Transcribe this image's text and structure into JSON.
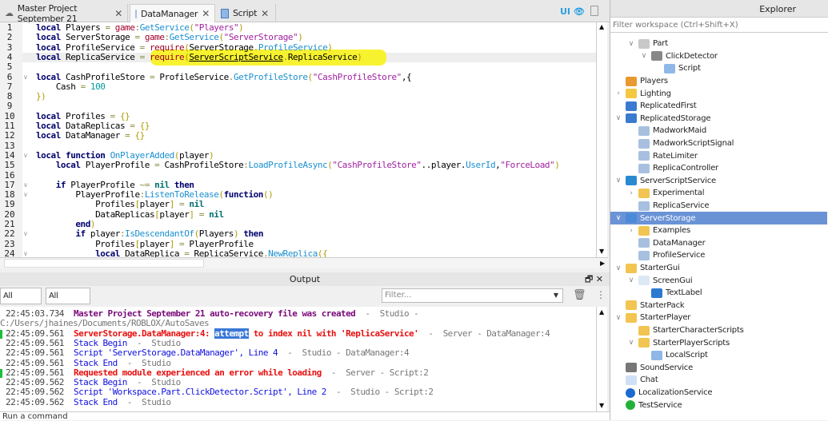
{
  "tabs": [
    {
      "label": "Master Project September 21",
      "icon": "cloud-icon",
      "active": false
    },
    {
      "label": "DataManager",
      "icon": "module-script-icon",
      "active": true
    },
    {
      "label": "Script",
      "icon": "script-icon",
      "active": false
    }
  ],
  "toolbar": {
    "ui_toggle": "UI"
  },
  "editor": {
    "current_line": 4,
    "highlight_color": "#f7f21a",
    "lines": [
      {
        "n": "1",
        "fold": false,
        "t": [
          [
            "kw",
            "local"
          ],
          [
            "id",
            " Players "
          ],
          [
            "op",
            "="
          ],
          [
            "req",
            " game"
          ],
          [
            "op",
            ":"
          ],
          [
            "fn",
            "GetService"
          ],
          [
            "br",
            "("
          ],
          [
            "str",
            "\"Players\""
          ],
          [
            "br",
            ")"
          ]
        ]
      },
      {
        "n": "2",
        "fold": false,
        "t": [
          [
            "kw",
            "local"
          ],
          [
            "id",
            " ServerStorage "
          ],
          [
            "op",
            "="
          ],
          [
            "req",
            " game"
          ],
          [
            "op",
            ":"
          ],
          [
            "fn",
            "GetService"
          ],
          [
            "br",
            "("
          ],
          [
            "str",
            "\"ServerStorage\""
          ],
          [
            "br",
            ")"
          ]
        ]
      },
      {
        "n": "3",
        "fold": false,
        "t": [
          [
            "kw",
            "local"
          ],
          [
            "id",
            " ProfileService "
          ],
          [
            "op",
            "="
          ],
          [
            "req",
            " require"
          ],
          [
            "br",
            "("
          ],
          [
            "id",
            "ServerStorage"
          ],
          [
            "op",
            "."
          ],
          [
            "fn",
            "ProfileService"
          ],
          [
            "br",
            ")"
          ]
        ]
      },
      {
        "n": "4",
        "fold": false,
        "t": [
          [
            "kw",
            "local"
          ],
          [
            "id",
            " ReplicaService "
          ],
          [
            "op",
            "= "
          ],
          [
            "req",
            "require"
          ],
          [
            "br",
            "("
          ],
          [
            "und",
            "ServerScriptService"
          ],
          [
            "op",
            "."
          ],
          [
            "id",
            "ReplicaService"
          ],
          [
            "br",
            ")"
          ]
        ]
      },
      {
        "n": "5",
        "fold": false,
        "t": []
      },
      {
        "n": "6",
        "fold": true,
        "t": [
          [
            "kw",
            "local"
          ],
          [
            "id",
            " CashProfileStore "
          ],
          [
            "op",
            "="
          ],
          [
            "id",
            " ProfileService"
          ],
          [
            "op",
            "."
          ],
          [
            "fn",
            "GetProfileStore"
          ],
          [
            "br",
            "("
          ],
          [
            "str",
            "\"CashProfileStore\""
          ],
          [
            "id",
            ",{"
          ]
        ]
      },
      {
        "n": "7",
        "fold": false,
        "t": [
          [
            "id",
            "    Cash "
          ],
          [
            "op",
            "="
          ],
          [
            "num",
            " 100"
          ]
        ]
      },
      {
        "n": "8",
        "fold": false,
        "t": [
          [
            "br",
            "})"
          ]
        ]
      },
      {
        "n": "9",
        "fold": false,
        "t": []
      },
      {
        "n": "10",
        "fold": false,
        "t": [
          [
            "kw",
            "local"
          ],
          [
            "id",
            " Profiles "
          ],
          [
            "op",
            "="
          ],
          [
            "br",
            " {}"
          ]
        ]
      },
      {
        "n": "11",
        "fold": false,
        "t": [
          [
            "kw",
            "local"
          ],
          [
            "id",
            " DataReplicas "
          ],
          [
            "op",
            "="
          ],
          [
            "br",
            " {}"
          ]
        ]
      },
      {
        "n": "12",
        "fold": false,
        "t": [
          [
            "kw",
            "local"
          ],
          [
            "id",
            " DataManager "
          ],
          [
            "op",
            "="
          ],
          [
            "br",
            " {}"
          ]
        ]
      },
      {
        "n": "13",
        "fold": false,
        "t": []
      },
      {
        "n": "14",
        "fold": true,
        "t": [
          [
            "kw",
            "local function"
          ],
          [
            "fn",
            " OnPlayerAdded"
          ],
          [
            "br",
            "("
          ],
          [
            "id",
            "player"
          ],
          [
            "br",
            ")"
          ]
        ]
      },
      {
        "n": "15",
        "fold": false,
        "t": [
          [
            "kw",
            "    local"
          ],
          [
            "id",
            " PlayerProfile "
          ],
          [
            "op",
            "="
          ],
          [
            "id",
            " CashProfileStore"
          ],
          [
            "op",
            ":"
          ],
          [
            "fn",
            "LoadProfileAsync"
          ],
          [
            "br",
            "("
          ],
          [
            "str",
            "\"CashProfileStore\""
          ],
          [
            "id",
            "..player."
          ],
          [
            "fn",
            "UserId"
          ],
          [
            "id",
            ","
          ],
          [
            "str",
            "\"ForceLoad\""
          ],
          [
            "br",
            ")"
          ]
        ]
      },
      {
        "n": "16",
        "fold": false,
        "t": []
      },
      {
        "n": "17",
        "fold": true,
        "t": [
          [
            "kw",
            "    if"
          ],
          [
            "id",
            " PlayerProfile "
          ],
          [
            "op",
            "~="
          ],
          [
            "nil",
            " nil"
          ],
          [
            "kw",
            " then"
          ]
        ]
      },
      {
        "n": "18",
        "fold": true,
        "t": [
          [
            "id",
            "        PlayerProfile"
          ],
          [
            "op",
            ":"
          ],
          [
            "fn",
            "ListenToRelease"
          ],
          [
            "br",
            "("
          ],
          [
            "kw",
            "function"
          ],
          [
            "br",
            "()"
          ]
        ]
      },
      {
        "n": "19",
        "fold": false,
        "t": [
          [
            "id",
            "            Profiles"
          ],
          [
            "br",
            "["
          ],
          [
            "id",
            "player"
          ],
          [
            "br",
            "]"
          ],
          [
            "op",
            " ="
          ],
          [
            "nil",
            " nil"
          ]
        ]
      },
      {
        "n": "20",
        "fold": false,
        "t": [
          [
            "id",
            "            DataReplicas"
          ],
          [
            "br",
            "["
          ],
          [
            "id",
            "player"
          ],
          [
            "br",
            "]"
          ],
          [
            "op",
            " ="
          ],
          [
            "nil",
            " nil"
          ]
        ]
      },
      {
        "n": "21",
        "fold": false,
        "t": [
          [
            "kw",
            "        end"
          ],
          [
            "br",
            ")"
          ]
        ]
      },
      {
        "n": "22",
        "fold": true,
        "t": [
          [
            "kw",
            "        if"
          ],
          [
            "id",
            " player"
          ],
          [
            "op",
            ":"
          ],
          [
            "fn",
            "IsDescendantOf"
          ],
          [
            "br",
            "("
          ],
          [
            "id",
            "Players"
          ],
          [
            "br",
            ")"
          ],
          [
            "kw",
            " then"
          ]
        ]
      },
      {
        "n": "23",
        "fold": false,
        "t": [
          [
            "id",
            "            Profiles"
          ],
          [
            "br",
            "["
          ],
          [
            "id",
            "player"
          ],
          [
            "br",
            "]"
          ],
          [
            "op",
            " ="
          ],
          [
            "id",
            " PlayerProfile"
          ]
        ]
      },
      {
        "n": "24",
        "fold": true,
        "t": [
          [
            "kw",
            "            local"
          ],
          [
            "id",
            " DataReplica "
          ],
          [
            "op",
            "="
          ],
          [
            "id",
            " ReplicaService"
          ],
          [
            "op",
            "."
          ],
          [
            "fn",
            "NewReplica"
          ],
          [
            "br",
            "({"
          ]
        ]
      }
    ]
  },
  "output": {
    "title": "Output",
    "messages_filter": "All Messages",
    "contexts_filter": "All Contexts",
    "filter_placeholder": "Filter...",
    "command_placeholder": "Run a command",
    "entries": [
      {
        "time": "22:45:03.734",
        "msg": "Master Project September 21 auto-recovery file was created",
        "style": "purple",
        "src": "Studio - C:/Users/jhaines/Documents/ROBLOX/AutoSaves",
        "mark": false
      },
      {
        "time": "22:45:09.561",
        "msg_pre": "ServerStorage.DataManager:4: ",
        "msg_sel": "attempt",
        "msg": " to index nil with 'ReplicaService'",
        "style": "red",
        "src": "Server - DataManager:4",
        "mark": true
      },
      {
        "time": "22:45:09.561",
        "msg": "Stack Begin",
        "style": "blue",
        "src": "Studio",
        "mark": false
      },
      {
        "time": "22:45:09.561",
        "msg": "Script 'ServerStorage.DataManager', Line 4",
        "style": "blue",
        "src": "Studio - DataManager:4",
        "mark": false
      },
      {
        "time": "22:45:09.561",
        "msg": "Stack End",
        "style": "blue",
        "src": "Studio",
        "mark": false
      },
      {
        "time": "22:45:09.561",
        "msg": "Requested module experienced an error while loading",
        "style": "red",
        "src": "Server - Script:2",
        "mark": true
      },
      {
        "time": "22:45:09.562",
        "msg": "Stack Begin",
        "style": "blue",
        "src": "Studio",
        "mark": false
      },
      {
        "time": "22:45:09.562",
        "msg": "Script 'Workspace.Part.ClickDetector.Script', Line 2",
        "style": "blue",
        "src": "Studio - Script:2",
        "mark": false
      },
      {
        "time": "22:45:09.562",
        "msg": "Stack End",
        "style": "blue",
        "src": "Studio",
        "mark": false
      }
    ]
  },
  "explorer": {
    "title": "Explorer",
    "filter_placeholder": "Filter workspace (Ctrl+Shift+X)",
    "items": [
      {
        "label": "Part",
        "depth": 1,
        "exp": "open",
        "icon": "part-icon",
        "color": "#c8c8c8"
      },
      {
        "label": "ClickDetector",
        "depth": 2,
        "exp": "open",
        "icon": "click-detector-icon",
        "color": "#888"
      },
      {
        "label": "Script",
        "depth": 3,
        "exp": "",
        "icon": "script-icon",
        "color": "#8fb8e8"
      },
      {
        "label": "Players",
        "depth": 0,
        "exp": "",
        "icon": "players-icon",
        "color": "#e89a30"
      },
      {
        "label": "Lighting",
        "depth": 0,
        "exp": "closed",
        "icon": "lightbulb-icon",
        "color": "#f5c842"
      },
      {
        "label": "ReplicatedFirst",
        "depth": 0,
        "exp": "",
        "icon": "replicated-first-icon",
        "color": "#3a7ad0"
      },
      {
        "label": "ReplicatedStorage",
        "depth": 0,
        "exp": "open",
        "icon": "replicated-storage-icon",
        "color": "#3a7ad0"
      },
      {
        "label": "MadworkMaid",
        "depth": 1,
        "exp": "",
        "icon": "module-script-icon",
        "color": "#a8c0e0"
      },
      {
        "label": "MadworkScriptSignal",
        "depth": 1,
        "exp": "",
        "icon": "module-script-icon",
        "color": "#a8c0e0"
      },
      {
        "label": "RateLimiter",
        "depth": 1,
        "exp": "",
        "icon": "module-script-icon",
        "color": "#a8c0e0"
      },
      {
        "label": "ReplicaController",
        "depth": 1,
        "exp": "",
        "icon": "module-script-icon",
        "color": "#a8c0e0"
      },
      {
        "label": "ServerScriptService",
        "depth": 0,
        "exp": "open",
        "icon": "server-script-service-icon",
        "color": "#2a8ad0"
      },
      {
        "label": "Experimental",
        "depth": 1,
        "exp": "closed",
        "icon": "folder-icon",
        "color": "#f2c552"
      },
      {
        "label": "ReplicaService",
        "depth": 1,
        "exp": "",
        "icon": "module-script-icon",
        "color": "#a8c0e0"
      },
      {
        "label": "ServerStorage",
        "depth": 0,
        "exp": "open",
        "icon": "server-storage-icon",
        "color": "#4a8ad8",
        "selected": true
      },
      {
        "label": "Examples",
        "depth": 1,
        "exp": "closed",
        "icon": "folder-icon",
        "color": "#f2c552"
      },
      {
        "label": "DataManager",
        "depth": 1,
        "exp": "",
        "icon": "module-script-icon",
        "color": "#a8c0e0"
      },
      {
        "label": "ProfileService",
        "depth": 1,
        "exp": "",
        "icon": "module-script-icon",
        "color": "#a8c0e0"
      },
      {
        "label": "StarterGui",
        "depth": 0,
        "exp": "open",
        "icon": "starter-gui-icon",
        "color": "#f2c552"
      },
      {
        "label": "ScreenGui",
        "depth": 1,
        "exp": "open",
        "icon": "screen-gui-icon",
        "color": "#dce8f5"
      },
      {
        "label": "TextLabel",
        "depth": 2,
        "exp": "",
        "icon": "text-label-icon",
        "color": "#2a7ad0"
      },
      {
        "label": "StarterPack",
        "depth": 0,
        "exp": "",
        "icon": "starter-pack-icon",
        "color": "#f2c552"
      },
      {
        "label": "StarterPlayer",
        "depth": 0,
        "exp": "open",
        "icon": "starter-player-icon",
        "color": "#f2c552"
      },
      {
        "label": "StarterCharacterScripts",
        "depth": 1,
        "exp": "",
        "icon": "folder-script-icon",
        "color": "#f2c552"
      },
      {
        "label": "StarterPlayerScripts",
        "depth": 1,
        "exp": "open",
        "icon": "folder-script-icon",
        "color": "#f2c552"
      },
      {
        "label": "LocalScript",
        "depth": 2,
        "exp": "",
        "icon": "local-script-icon",
        "color": "#8fb8e8"
      },
      {
        "label": "SoundService",
        "depth": 0,
        "exp": "",
        "icon": "speaker-icon",
        "color": "#777"
      },
      {
        "label": "Chat",
        "depth": 0,
        "exp": "",
        "icon": "chat-icon",
        "color": "#cfe0f5"
      },
      {
        "label": "LocalizationService",
        "depth": 0,
        "exp": "",
        "icon": "globe-icon",
        "color": "#1a6ad0"
      },
      {
        "label": "TestService",
        "depth": 0,
        "exp": "",
        "icon": "check-circle-icon",
        "color": "#22b03a"
      }
    ]
  }
}
